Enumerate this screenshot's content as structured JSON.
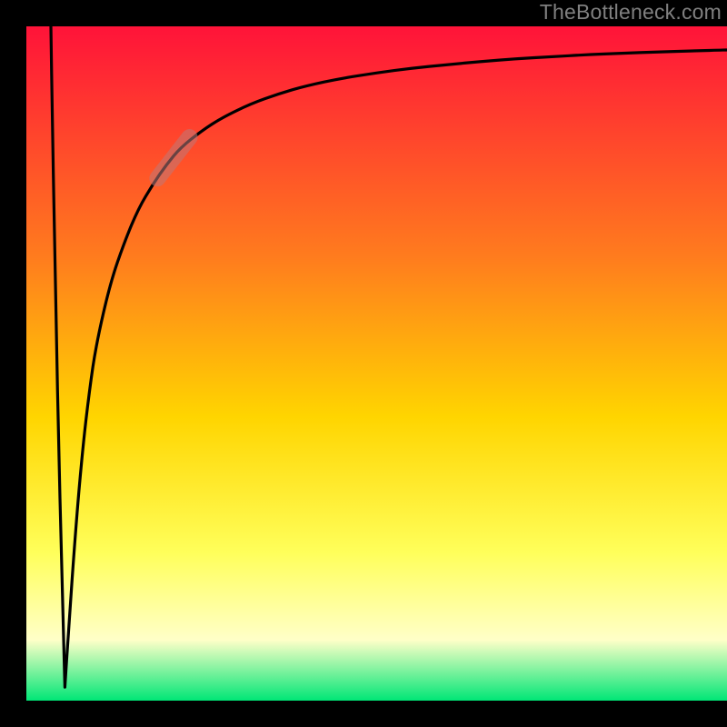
{
  "watermark": "TheBottleneck.com",
  "colors": {
    "top": "#ff1339",
    "mid_upper": "#ff7b1e",
    "mid": "#ffd500",
    "mid_lower": "#ffff5a",
    "pale": "#ffffc8",
    "bottom": "#00e676",
    "curve": "#000000",
    "highlight": "rgba(190,120,120,0.55)"
  },
  "chart_data": {
    "type": "line",
    "title": "",
    "xlabel": "",
    "ylabel": "",
    "xlim": [
      0,
      100
    ],
    "ylim": [
      0,
      100
    ],
    "annotations": [
      {
        "kind": "highlight-segment",
        "x_range": [
          18,
          24
        ],
        "note": "shaded band on curve"
      }
    ],
    "series": [
      {
        "name": "left-descent",
        "x": [
          3.5,
          3.7,
          4.0,
          4.3,
          4.6,
          5.0,
          5.3,
          5.5
        ],
        "values": [
          100,
          86,
          70,
          54,
          38,
          22,
          10,
          2
        ]
      },
      {
        "name": "main-curve",
        "x": [
          5.5,
          6.0,
          7.0,
          8.0,
          9.0,
          10.0,
          12.0,
          14.0,
          16.0,
          18.0,
          20.0,
          22.0,
          25.0,
          28.0,
          32.0,
          36.0,
          40.0,
          45.0,
          50.0,
          55.0,
          60.0,
          65.0,
          70.0,
          75.0,
          80.0,
          85.0,
          90.0,
          95.0,
          100.0
        ],
        "values": [
          2,
          10,
          25,
          37,
          46,
          53,
          62,
          68,
          73,
          76.5,
          79.5,
          82,
          84.5,
          86.5,
          88.5,
          90,
          91.2,
          92.3,
          93.1,
          93.8,
          94.3,
          94.8,
          95.2,
          95.5,
          95.8,
          96.0,
          96.2,
          96.35,
          96.5
        ]
      }
    ]
  }
}
